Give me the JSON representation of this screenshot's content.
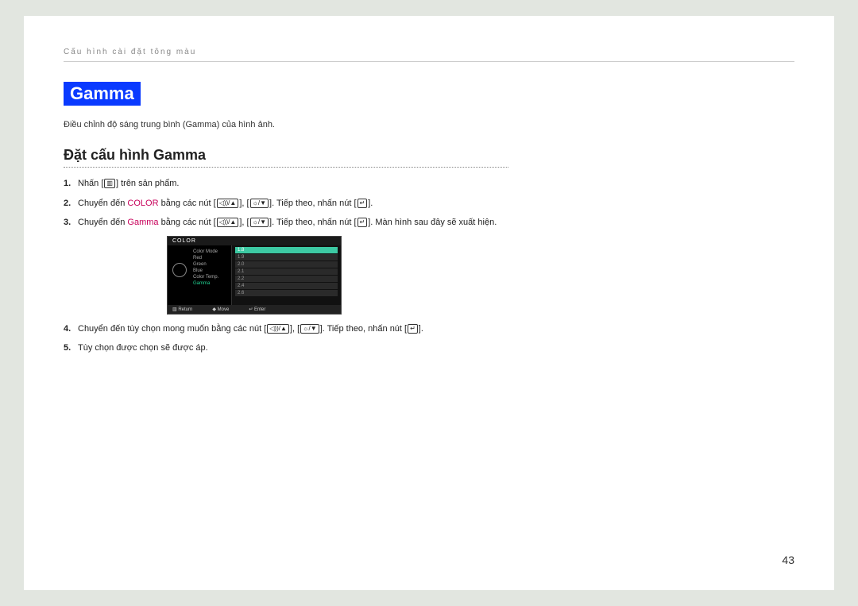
{
  "breadcrumb": "Cấu hình cài đặt tông màu",
  "title_badge": "Gamma",
  "description": "Điều chỉnh độ sáng trung bình (Gamma) của hình ảnh.",
  "subheading": "Đặt cấu hình Gamma",
  "steps": {
    "s1_num": "1.",
    "s1_a": " Nhấn [",
    "s1_b": "] trên sản phẩm.",
    "s2_num": "2.",
    "s2_a": " Chuyển đến ",
    "s2_color": "COLOR",
    "s2_b": " bằng các nút [",
    "s2_c": "], [",
    "s2_d": "]. Tiếp theo, nhấn nút [",
    "s2_e": "].",
    "s3_num": "3.",
    "s3_a": " Chuyển đến ",
    "s3_color": "Gamma",
    "s3_b": " bằng các nút [",
    "s3_c": "], [",
    "s3_d": "]. Tiếp theo, nhấn nút [",
    "s3_e": "]. Màn hình sau đây sẽ xuất hiện.",
    "s4_num": "4.",
    "s4_a": " Chuyển đến tùy chọn mong muốn bằng các nút [",
    "s4_b": "], [",
    "s4_c": "]. Tiếp theo, nhấn nút [",
    "s4_d": "].",
    "s5_num": "5.",
    "s5_text": " Tùy chọn được chọn sẽ được áp."
  },
  "osd": {
    "header": "COLOR",
    "menu": [
      "Color Mode",
      "Red",
      "Green",
      "Blue",
      "Color Temp.",
      "Gamma"
    ],
    "options": [
      "1.8",
      "1.9",
      "2.0",
      "2.1",
      "2.2",
      "2.4",
      "2.6"
    ],
    "footer_return": "Return",
    "footer_move": "Move",
    "footer_enter": "Enter"
  },
  "page_number": "43",
  "icons": {
    "menu": "▥",
    "vol_up": "◁))/▲",
    "bright_down": "☼/▼",
    "enter": "↵"
  }
}
